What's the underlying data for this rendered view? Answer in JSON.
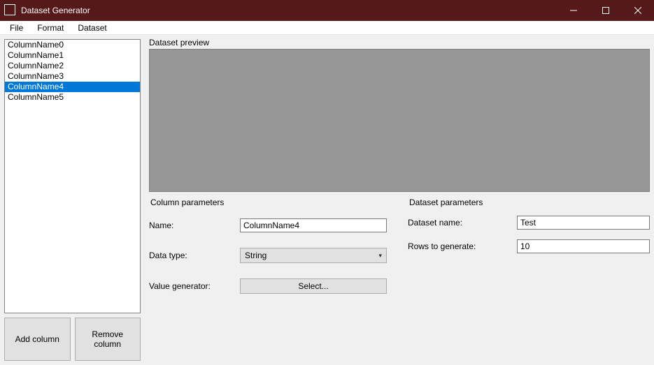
{
  "window": {
    "title": "Dataset Generator"
  },
  "menu": {
    "file": "File",
    "format": "Format",
    "dataset": "Dataset"
  },
  "columns": {
    "items": [
      {
        "label": "ColumnName0"
      },
      {
        "label": "ColumnName1"
      },
      {
        "label": "ColumnName2"
      },
      {
        "label": "ColumnName3"
      },
      {
        "label": "ColumnName4"
      },
      {
        "label": "ColumnName5"
      }
    ],
    "selected_index": 4
  },
  "buttons": {
    "add_column": "Add column",
    "remove_column": "Remove column"
  },
  "preview": {
    "title": "Dataset preview"
  },
  "column_params": {
    "title": "Column parameters",
    "name_label": "Name:",
    "name_value": "ColumnName4",
    "data_type_label": "Data type:",
    "data_type_value": "String",
    "value_gen_label": "Value generator:",
    "value_gen_button": "Select..."
  },
  "dataset_params": {
    "title": "Dataset parameters",
    "name_label": "Dataset name:",
    "name_value": "Test",
    "rows_label": "Rows to generate:",
    "rows_value": "10"
  }
}
